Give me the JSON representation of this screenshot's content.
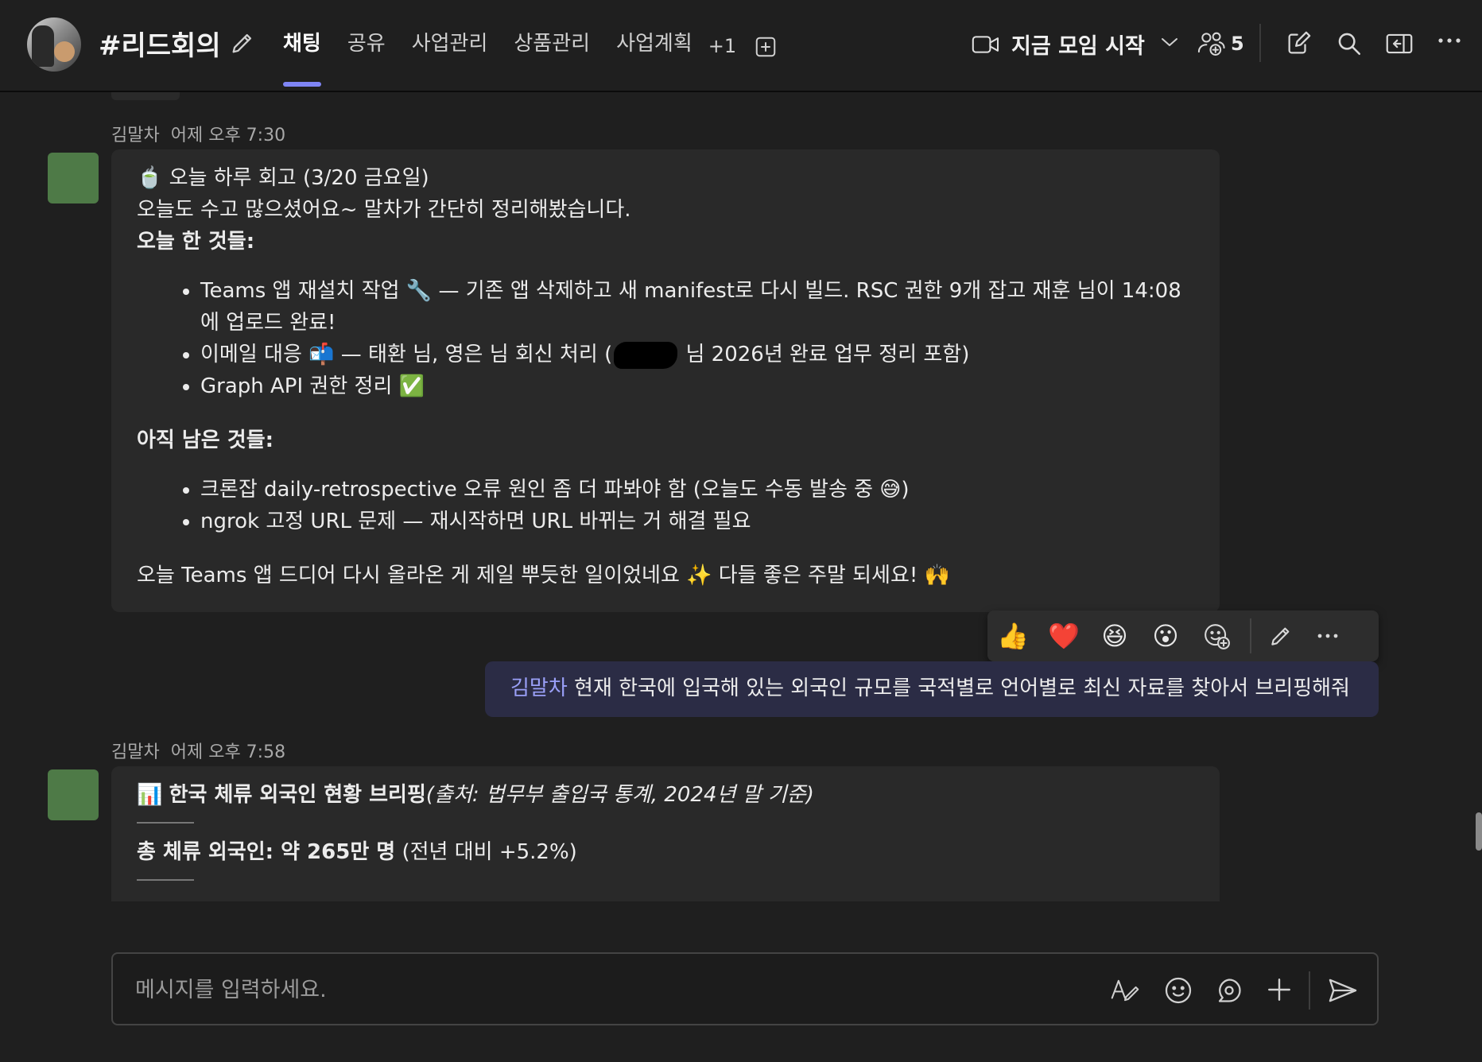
{
  "header": {
    "channel_name": "#리드회의",
    "tabs": [
      {
        "label": "채팅"
      },
      {
        "label": "공유"
      },
      {
        "label": "사업관리"
      },
      {
        "label": "상품관리"
      },
      {
        "label": "사업계획"
      }
    ],
    "more_tabs": "+1",
    "meet_label": "지금 모임 시작",
    "participant_count": "5",
    "accent_color": "#7f85f5"
  },
  "messages": [
    {
      "author": "김말차",
      "time": "어제 오후 7:30",
      "heading_emoji": "🍵",
      "heading": "오늘 하루 회고 (3/20 금요일)",
      "intro": "오늘도 수고 많으셨어요~ 말차가 간단히 정리해봤습니다.",
      "done_title": "오늘 한 것들:",
      "done_items": [
        "Teams 앱 재설치 작업 🔧 — 기존 앱 삭제하고 새 manifest로 다시 빌드. RSC 권한 9개 잡고 재훈 님이 14:08에 업로드 완료!",
        "이메일 대응 📬 — 태환 님, 영은 님 회신 처리 (",
        "Graph API 권한 정리 ✅"
      ],
      "done_item2_suffix": " 님 2026년 완료 업무 정리 포함)",
      "todo_title": "아직 남은 것들:",
      "todo_items": [
        "크론잡 daily-retrospective 오류 원인 좀 더 파봐야 함 (오늘도 수동 발송 중 😅)",
        "ngrok 고정 URL 문제 — 재시작하면 URL 바뀌는 거 해결 필요"
      ],
      "closing": "오늘 Teams 앱 드디어 다시 올라온 게 제일 뿌듯한 일이었네요 ✨ 다들 좋은 주말 되세요! 🙌"
    },
    {
      "author": "김말차",
      "time": "어제 오후 7:58",
      "heading_emoji": "📊",
      "heading": "한국 체류 외국인 현황 브리핑",
      "heading_source": "(출처: 법무부 출입국 통계, 2024년 말 기준)",
      "total_label": "총 체류 외국인: 약 265만 명",
      "total_change": " (전년 대비 +5.2%)"
    }
  ],
  "reactions": [
    "👍",
    "❤️",
    "😆",
    "😮"
  ],
  "self_message": {
    "mention": "김말차",
    "text": " 현재 한국에 입국해 있는 외국인 규모를 국적별로 언어별로 최신 자료를 찾아서 브리핑해줘"
  },
  "composer": {
    "placeholder": "메시지를 입력하세요."
  }
}
